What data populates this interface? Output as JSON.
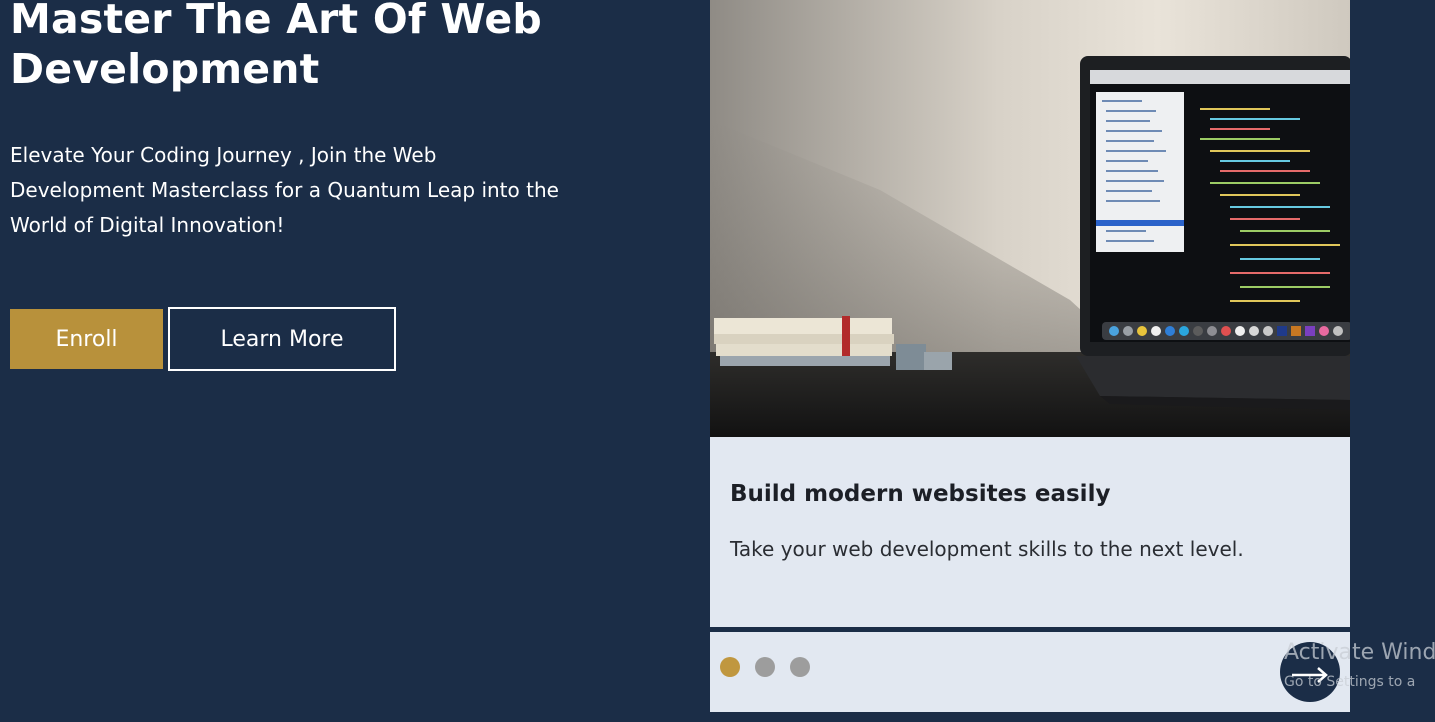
{
  "hero": {
    "title_line1": "Master The Art Of Web",
    "title_line2": "Development",
    "subtitle_line1": "Elevate Your Coding Journey , Join the Web",
    "subtitle_line2": "Development Masterclass for a Quantum Leap into the",
    "subtitle_line3": "World of Digital Innovation!",
    "enroll_label": "Enroll",
    "learn_more_label": "Learn More"
  },
  "slider": {
    "image_label": "laptop-on-desk-with-code-editor",
    "slide_title": "Build modern websites easily",
    "slide_text": "Take your web development skills to the next level.",
    "slide_count": 3,
    "active_slide": 1
  },
  "watermark": {
    "title": "Activate Wind",
    "subtitle": "Go to Settings to a"
  },
  "colors": {
    "background": "#1b2d47",
    "accent": "#b8913b",
    "card": "#e2e8f1",
    "dot_inactive": "#9d9d9d"
  }
}
